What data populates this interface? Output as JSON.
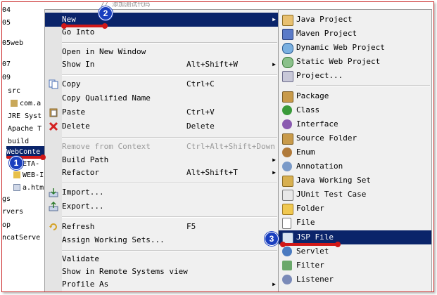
{
  "background": {
    "top_text": "// 添加测试代码",
    "tree": [
      {
        "label": "04",
        "selected": false
      },
      {
        "label": "05",
        "selected": false
      },
      {
        "label": "05web",
        "selected": false
      },
      {
        "label": "07",
        "selected": false
      },
      {
        "label": "09",
        "selected": false
      },
      {
        "label": "src",
        "selected": false
      },
      {
        "label": "com.a",
        "selected": false
      },
      {
        "label": "JRE Syst",
        "selected": false
      },
      {
        "label": "Apache T",
        "selected": false
      },
      {
        "label": "build",
        "selected": false
      },
      {
        "label": "WebConte",
        "selected": true
      },
      {
        "label": "META-",
        "selected": false
      },
      {
        "label": "WEB-I",
        "selected": false
      },
      {
        "label": "a.htm",
        "selected": false
      },
      {
        "label": "gs",
        "selected": false
      },
      {
        "label": "rvers",
        "selected": false
      },
      {
        "label": "op",
        "selected": false
      },
      {
        "label": "ncatServe",
        "selected": false
      }
    ]
  },
  "context_menu": {
    "items": [
      {
        "label": "New",
        "shortcut": "",
        "submenu": true,
        "highlighted": true,
        "disabled": false,
        "icon": ""
      },
      {
        "label": "Go Into",
        "shortcut": "",
        "submenu": false,
        "highlighted": false,
        "disabled": false,
        "icon": ""
      },
      {
        "label": "Open in New Window",
        "shortcut": "",
        "submenu": false,
        "highlighted": false,
        "disabled": false,
        "icon": ""
      },
      {
        "label": "Show In",
        "shortcut": "Alt+Shift+W",
        "submenu": true,
        "highlighted": false,
        "disabled": false,
        "icon": ""
      },
      {
        "label": "Copy",
        "shortcut": "Ctrl+C",
        "submenu": false,
        "highlighted": false,
        "disabled": false,
        "icon": "copy-icon"
      },
      {
        "label": "Copy Qualified Name",
        "shortcut": "",
        "submenu": false,
        "highlighted": false,
        "disabled": false,
        "icon": ""
      },
      {
        "label": "Paste",
        "shortcut": "Ctrl+V",
        "submenu": false,
        "highlighted": false,
        "disabled": false,
        "icon": "paste-icon"
      },
      {
        "label": "Delete",
        "shortcut": "Delete",
        "submenu": false,
        "highlighted": false,
        "disabled": false,
        "icon": "delete-icon"
      },
      {
        "label": "Remove from Context",
        "shortcut": "Ctrl+Alt+Shift+Down",
        "submenu": false,
        "highlighted": false,
        "disabled": true,
        "icon": ""
      },
      {
        "label": "Build Path",
        "shortcut": "",
        "submenu": true,
        "highlighted": false,
        "disabled": false,
        "icon": ""
      },
      {
        "label": "Refactor",
        "shortcut": "Alt+Shift+T",
        "submenu": true,
        "highlighted": false,
        "disabled": false,
        "icon": ""
      },
      {
        "label": "Import...",
        "shortcut": "",
        "submenu": false,
        "highlighted": false,
        "disabled": false,
        "icon": "import-icon"
      },
      {
        "label": "Export...",
        "shortcut": "",
        "submenu": false,
        "highlighted": false,
        "disabled": false,
        "icon": "export-icon"
      },
      {
        "label": "Refresh",
        "shortcut": "F5",
        "submenu": false,
        "highlighted": false,
        "disabled": false,
        "icon": "refresh-icon"
      },
      {
        "label": "Assign Working Sets...",
        "shortcut": "",
        "submenu": false,
        "highlighted": false,
        "disabled": false,
        "icon": ""
      },
      {
        "label": "Validate",
        "shortcut": "",
        "submenu": false,
        "highlighted": false,
        "disabled": false,
        "icon": ""
      },
      {
        "label": "Show in Remote Systems view",
        "shortcut": "",
        "submenu": false,
        "highlighted": false,
        "disabled": false,
        "icon": ""
      },
      {
        "label": "Profile As",
        "shortcut": "",
        "submenu": true,
        "highlighted": false,
        "disabled": false,
        "icon": ""
      }
    ]
  },
  "new_submenu": {
    "items": [
      {
        "label": "Java Project",
        "icon": "java-project-icon",
        "highlighted": false
      },
      {
        "label": "Maven Project",
        "icon": "maven-project-icon",
        "highlighted": false
      },
      {
        "label": "Dynamic Web Project",
        "icon": "dynamic-web-project-icon",
        "highlighted": false
      },
      {
        "label": "Static Web Project",
        "icon": "static-web-project-icon",
        "highlighted": false
      },
      {
        "label": "Project...",
        "icon": "project-icon",
        "highlighted": false
      },
      {
        "label": "Package",
        "icon": "package-icon",
        "highlighted": false
      },
      {
        "label": "Class",
        "icon": "class-icon",
        "highlighted": false
      },
      {
        "label": "Interface",
        "icon": "interface-icon",
        "highlighted": false
      },
      {
        "label": "Source Folder",
        "icon": "source-folder-icon",
        "highlighted": false
      },
      {
        "label": "Enum",
        "icon": "enum-icon",
        "highlighted": false
      },
      {
        "label": "Annotation",
        "icon": "annotation-icon",
        "highlighted": false
      },
      {
        "label": "Java Working Set",
        "icon": "working-set-icon",
        "highlighted": false
      },
      {
        "label": "JUnit Test Case",
        "icon": "junit-icon",
        "highlighted": false
      },
      {
        "label": "Folder",
        "icon": "folder-icon",
        "highlighted": false
      },
      {
        "label": "File",
        "icon": "file-icon",
        "highlighted": false
      },
      {
        "label": "JSP File",
        "icon": "jsp-file-icon",
        "highlighted": true
      },
      {
        "label": "Servlet",
        "icon": "servlet-icon",
        "highlighted": false
      },
      {
        "label": "Filter",
        "icon": "filter-icon",
        "highlighted": false
      },
      {
        "label": "Listener",
        "icon": "listener-icon",
        "highlighted": false
      }
    ]
  },
  "annotations": {
    "step1": "1",
    "step2": "2",
    "step3": "3",
    "marker_color": "#d01818",
    "badge_color": "#1a3fbf"
  },
  "colors": {
    "highlight": "#0a246a",
    "menu_bg": "#f0f0f0"
  }
}
